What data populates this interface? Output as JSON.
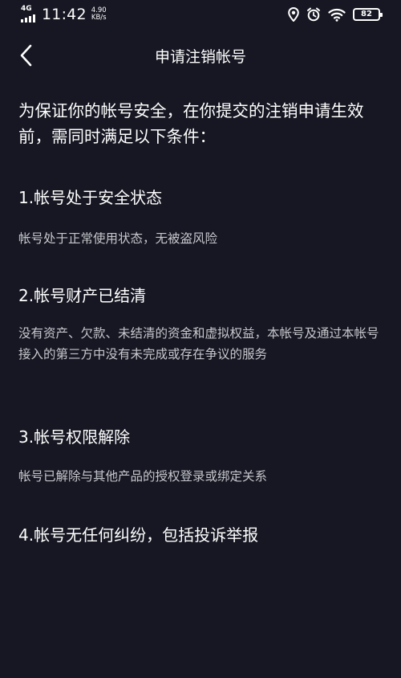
{
  "status_bar": {
    "network_type": "4G",
    "time": "11:42",
    "speed_value": "4.90",
    "speed_unit": "KB/s",
    "battery_level": "82",
    "icons": [
      "signal-bars-icon",
      "location-icon",
      "alarm-icon",
      "wifi-icon",
      "battery-icon"
    ]
  },
  "nav": {
    "back_icon": "chevron-left-icon",
    "title": "申请注销帐号"
  },
  "main": {
    "intro": "为保证你的帐号安全，在你提交的注销申请生效前，需同时满足以下条件：",
    "conditions": [
      {
        "heading": "1.帐号处于安全状态",
        "description": "帐号处于正常使用状态，无被盗风险"
      },
      {
        "heading": "2.帐号财产已结清",
        "description": "没有资产、欠款、未结清的资金和虚拟权益，本帐号及通过本帐号接入的第三方中没有未完成或存在争议的服务"
      },
      {
        "heading": "3.帐号权限解除",
        "description": "帐号已解除与其他产品的授权登录或绑定关系"
      },
      {
        "heading": "4.帐号无任何纠纷，包括投诉举报",
        "description": ""
      }
    ]
  },
  "colors": {
    "background": "#161722",
    "primary_text": "#ffffff",
    "secondary_text": "#c7c8cd"
  }
}
